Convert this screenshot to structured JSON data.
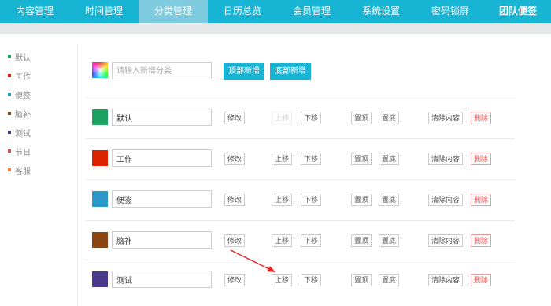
{
  "nav": {
    "tabs": [
      "内容管理",
      "时间管理",
      "分类管理",
      "日历总览",
      "会员管理",
      "系统设置",
      "密码锁屏",
      "团队便签"
    ],
    "active_index": 2
  },
  "sidebar": {
    "items": [
      {
        "label": "默认",
        "color": "#1aa260"
      },
      {
        "label": "工作",
        "color": "#dd2200"
      },
      {
        "label": "便签",
        "color": "#2a9bc8"
      },
      {
        "label": "脑补",
        "color": "#8b4513"
      },
      {
        "label": "测试",
        "color": "#4b3a8a"
      },
      {
        "label": "节日",
        "color": "#e04a4a"
      },
      {
        "label": "客服",
        "color": "#ff7b3a"
      }
    ]
  },
  "add_row": {
    "placeholder": "请输入新增分类",
    "icon": "color-picker-icon",
    "top_add_label": "顶部新增",
    "bottom_add_label": "底部新增"
  },
  "rows": [
    {
      "name": "默认",
      "color": "#1aa260"
    },
    {
      "name": "工作",
      "color": "#dd2200"
    },
    {
      "name": "便签",
      "color": "#2a9bc8"
    },
    {
      "name": "脑补",
      "color": "#8b4513"
    },
    {
      "name": "测试",
      "color": "#4b3a8a"
    }
  ],
  "actions": {
    "edit": "修改",
    "move_up": "上移",
    "move_down": "下移",
    "pin_top": "置顶",
    "pin_bottom": "置底",
    "clear": "清除内容",
    "delete": "删除"
  },
  "annotation": {
    "type": "red-arrow",
    "points_to": "测试 上移",
    "color": "#ee2222"
  }
}
